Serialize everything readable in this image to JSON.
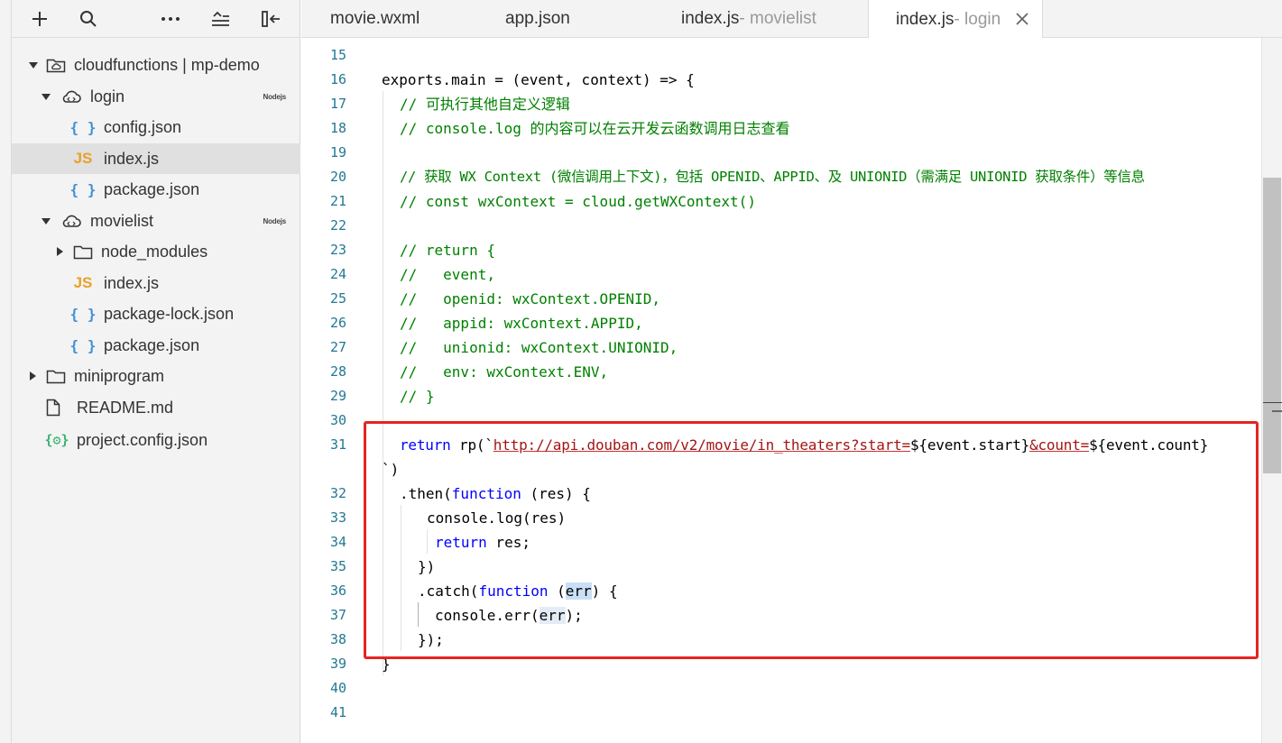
{
  "sidebar": {
    "toolbar": [
      {
        "name": "add",
        "icon": "plus-icon"
      },
      {
        "name": "search",
        "icon": "search-icon"
      },
      {
        "name": "more",
        "icon": "more-icon"
      },
      {
        "name": "collapse",
        "icon": "collapse-all-icon"
      },
      {
        "name": "hide-sidebar",
        "icon": "panel-collapse-icon"
      }
    ],
    "tree": [
      {
        "label": "cloudfunctions | mp-demo",
        "icon": "cloud-folder-icon"
      },
      {
        "label": "login",
        "icon": "cloud-function-icon",
        "badge": "Nodejs"
      },
      {
        "label": "config.json",
        "icon": "json-icon",
        "glyph": "{ }"
      },
      {
        "label": "index.js",
        "icon": "js-file-icon",
        "glyph": "JS",
        "selected": true
      },
      {
        "label": "package.json",
        "icon": "json-icon",
        "glyph": "{ }"
      },
      {
        "label": "movielist",
        "icon": "cloud-function-icon",
        "badge": "Nodejs"
      },
      {
        "label": "node_modules",
        "icon": "folder-icon"
      },
      {
        "label": "index.js",
        "icon": "js-file-icon",
        "glyph": "JS"
      },
      {
        "label": "package-lock.json",
        "icon": "json-icon",
        "glyph": "{ }"
      },
      {
        "label": "package.json",
        "icon": "json-icon",
        "glyph": "{ }"
      },
      {
        "label": "miniprogram",
        "icon": "folder-icon"
      },
      {
        "label": "README.md",
        "icon": "file-icon"
      },
      {
        "label": "project.config.json",
        "icon": "config-json-icon",
        "glyph": "{⚙}"
      }
    ]
  },
  "tabs": [
    {
      "name": "movie.wxml",
      "sub": ""
    },
    {
      "name": "app.json",
      "sub": ""
    },
    {
      "name": "index.js",
      "sub": " - movielist"
    },
    {
      "name": "index.js",
      "sub": " - login",
      "active": true
    }
  ],
  "editor": {
    "line_numbers": [
      "15",
      "16",
      "17",
      "18",
      "19",
      "20",
      "21",
      "22",
      "23",
      "24",
      "25",
      "26",
      "27",
      "28",
      "29",
      "30",
      "31",
      "32",
      "33",
      "34",
      "35",
      "36",
      "37",
      "38",
      "39",
      "40",
      "41"
    ],
    "code": {
      "l16": "exports.main = (event, context) => {",
      "l17": "// 可执行其他自定义逻辑",
      "l18": "// console.log 的内容可以在云开发云函数调用日志查看",
      "l20": "// 获取 WX Context (微信调用上下文)，包括 OPENID、APPID、及 UNIONID（需满足 UNIONID 获取条件）等信息",
      "l21": "// const wxContext = cloud.getWXContext()",
      "l23": "// return {",
      "l24": "//   event,",
      "l25": "//   openid: wxContext.OPENID,",
      "l26": "//   appid: wxContext.APPID,",
      "l27": "//   unionid: wxContext.UNIONID,",
      "l28": "//   env: wxContext.ENV,",
      "l29": "// }",
      "l31_kw": "return",
      "l31_a": " rp(`",
      "l31_url1": "http://api.douban.com/v2/movie/in_theaters?start=",
      "l31_var1": "${event.start}",
      "l31_url2": "&count=",
      "l31_var2": "${event.count}",
      "l31_wrap": "`)",
      "l32_a": ".then(",
      "l32_kw": "function",
      "l32_b": " (res) {",
      "l33": "console.log(res)",
      "l34_kw": "return",
      "l34_b": " res;",
      "l35": "})",
      "l36_a": ".catch(",
      "l36_kw": "function",
      "l36_b": " (",
      "l36_err": "err",
      "l36_c": ") {",
      "l37_a": "console.err(",
      "l37_err": "err",
      "l37_b": ");",
      "l38": "});",
      "l39": "}"
    }
  },
  "colors": {
    "comment": "#008000",
    "keyword": "#0000ff",
    "string": "#a31515",
    "line_number": "#237893",
    "highlight_box": "#e52422"
  }
}
